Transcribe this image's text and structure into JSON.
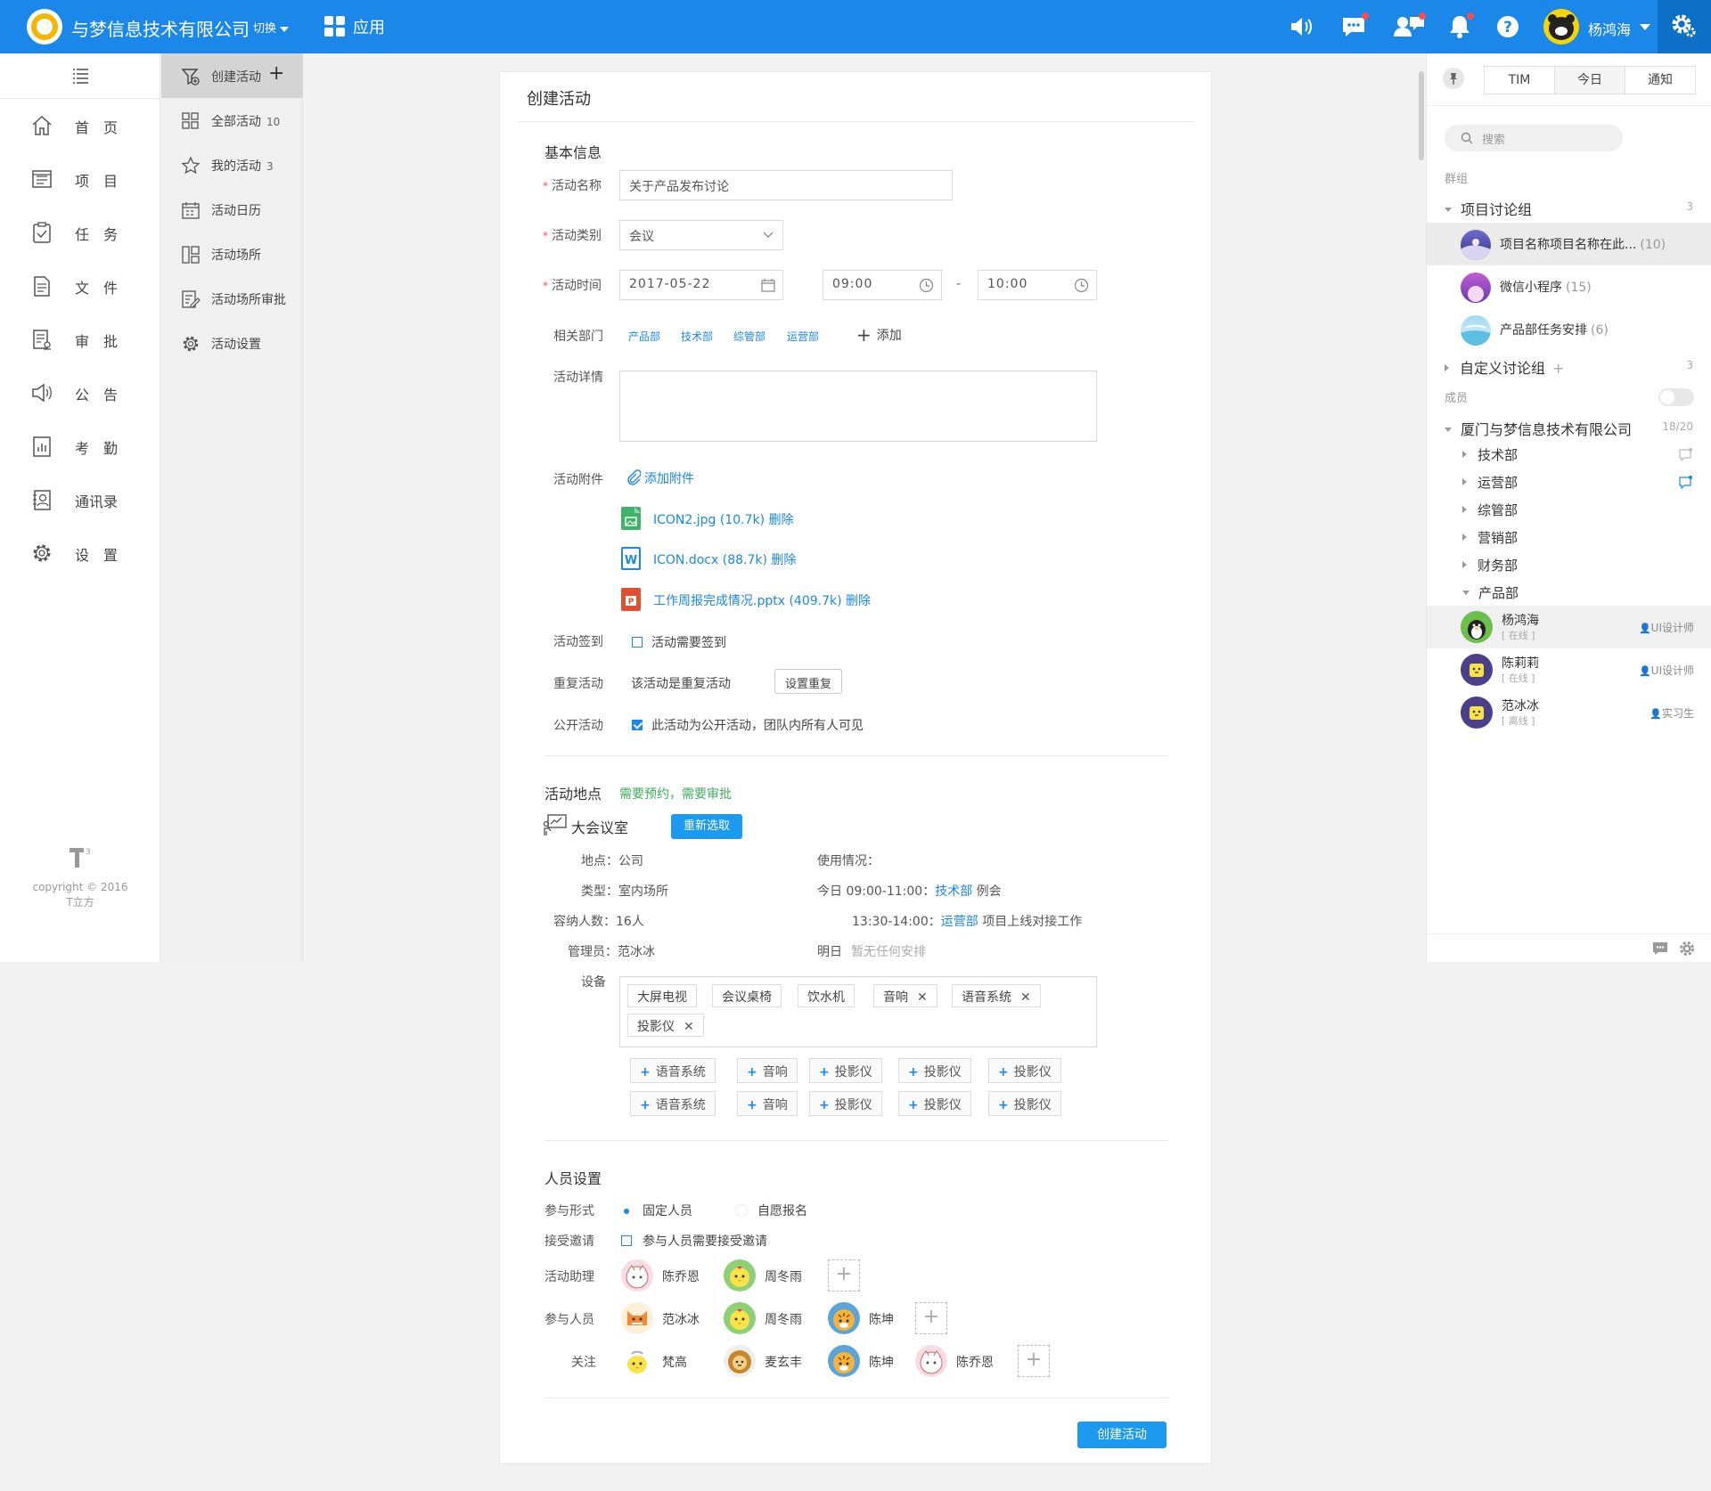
{
  "topbar": {
    "company": "与梦信息技术有限公司",
    "switch_label": "切换",
    "apps_label": "应用",
    "user_name": "杨鸿海",
    "colors": {
      "bar": "#1b87e8",
      "settings": "#0e6fc6"
    }
  },
  "leftnav": {
    "items": [
      {
        "label": "首　页",
        "icon": "home-icon"
      },
      {
        "label": "项　目",
        "icon": "project-icon"
      },
      {
        "label": "任　务",
        "icon": "task-icon"
      },
      {
        "label": "文　件",
        "icon": "file-icon"
      },
      {
        "label": "审　批",
        "icon": "approval-icon"
      },
      {
        "label": "公　告",
        "icon": "announcement-icon"
      },
      {
        "label": "考　勤",
        "icon": "attendance-icon"
      },
      {
        "label": "通讯录",
        "icon": "contacts-icon"
      },
      {
        "label": "设　置",
        "icon": "settings-icon"
      }
    ],
    "copyright_line1": "copyright © 2016",
    "copyright_line2": "T立方"
  },
  "subnav": {
    "items": [
      {
        "label": "创建活动",
        "count": "",
        "active": true
      },
      {
        "label": "全部活动",
        "count": "10"
      },
      {
        "label": "我的活动",
        "count": "3"
      },
      {
        "label": "活动日历",
        "count": ""
      },
      {
        "label": "活动场所",
        "count": ""
      },
      {
        "label": "活动场所审批",
        "count": ""
      },
      {
        "label": "活动设置",
        "count": ""
      }
    ]
  },
  "form": {
    "title": "创建活动",
    "basic_title": "基本信息",
    "name_label": "活动名称",
    "name_value": "关于产品发布讨论",
    "type_label": "活动类别",
    "type_value": "会议",
    "time_label": "活动时间",
    "date_value": "2017-05-22",
    "start_time": "09:00",
    "dash": "-",
    "end_time": "10:00",
    "dept_label": "相关部门",
    "depts": [
      "产品部",
      "技术部",
      "综管部",
      "运营部"
    ],
    "add_label": "添加",
    "detail_label": "活动详情",
    "attach_label": "活动附件",
    "add_attach": "添加附件",
    "files": [
      {
        "name": "ICON2.jpg (10.7k) 删除",
        "type": "image",
        "color": "#3fb26b"
      },
      {
        "name": "ICON.docx (88.7k) 删除",
        "type": "word",
        "color": "#1b87e8"
      },
      {
        "name": "工作周报完成情况.pptx (409.7k) 删除",
        "type": "ppt",
        "color": "#e0502f"
      }
    ],
    "signin_label": "活动签到",
    "signin_text": "活动需要签到",
    "repeat_label": "重复活动",
    "repeat_text": "该活动是重复活动",
    "repeat_btn": "设置重复",
    "public_label": "公开活动",
    "public_text": "此活动为公开活动，团队内所有人可见"
  },
  "venue": {
    "title": "活动地点",
    "note": "需要预约，需要审批",
    "room": "大会议室",
    "reselect": "重新选取",
    "location": "地点：公司",
    "type": "类型：室内场所",
    "capacity": "容纳人数：16人",
    "admin": "管理员：范冰冰",
    "usage_title": "使用情况：",
    "usage1_prefix": "今日 09:00-11:00：",
    "usage1_dept": "技术部",
    "usage1_text": " 例会",
    "usage2_prefix": "13:30-14:00：",
    "usage2_dept": "运营部",
    "usage2_text": " 项目上线对接工作",
    "tomorrow": "明日",
    "tomorrow_text": "暂无任何安排",
    "equip_label": "设备",
    "equip_tags": [
      {
        "label": "大屏电视",
        "x": false
      },
      {
        "label": "会议桌椅",
        "x": false
      },
      {
        "label": "饮水机",
        "x": false
      },
      {
        "label": "音响",
        "x": true
      },
      {
        "label": "语音系统",
        "x": true
      },
      {
        "label": "投影仪",
        "x": true
      }
    ],
    "equip_add_row1": [
      "语音系统",
      "音响",
      "投影仪",
      "投影仪",
      "投影仪"
    ],
    "equip_add_row2": [
      "语音系统",
      "音响",
      "投影仪",
      "投影仪",
      "投影仪"
    ]
  },
  "people": {
    "title": "人员设置",
    "mode_label": "参与形式",
    "mode_fixed": "固定人员",
    "mode_volunteer": "自愿报名",
    "invite_label": "接受邀请",
    "invite_text": "参与人员需要接受邀请",
    "assist_label": "活动助理",
    "assistants": [
      "陈乔恩",
      "周冬雨"
    ],
    "participant_label": "参与人员",
    "participants": [
      "范冰冰",
      "周冬雨",
      "陈坤"
    ],
    "follow_label": "关注",
    "followers": [
      "梵高",
      "麦玄丰",
      "陈坤",
      "陈乔恩"
    ],
    "submit": "创建活动"
  },
  "rpanel": {
    "tabs": [
      "TIM",
      "今日",
      "通知"
    ],
    "search_placeholder": "搜索",
    "groups_header": "群组",
    "group1": "项目讨论组",
    "group1_count": "3",
    "chats": [
      {
        "name": "项目名称项目名称在此...",
        "count": "(10)"
      },
      {
        "name": "微信小程序",
        "count": "(15)"
      },
      {
        "name": "产品部任务安排",
        "count": "(6)"
      }
    ],
    "group2": "自定义讨论组",
    "group2_count": "3",
    "members_header": "成员",
    "company": "厦门与梦信息技术有限公司",
    "company_count": "18/20",
    "depts": [
      "技术部",
      "运营部",
      "综管部",
      "营销部",
      "财务部",
      "产品部"
    ],
    "members": [
      {
        "name": "杨鸿海",
        "status": "[ 在线 ]",
        "role": "UI设计师"
      },
      {
        "name": "陈莉莉",
        "status": "[ 在线 ]",
        "role": "UI设计师"
      },
      {
        "name": "范冰冰",
        "status": "[ 离线 ]",
        "role": "实习生"
      }
    ]
  }
}
